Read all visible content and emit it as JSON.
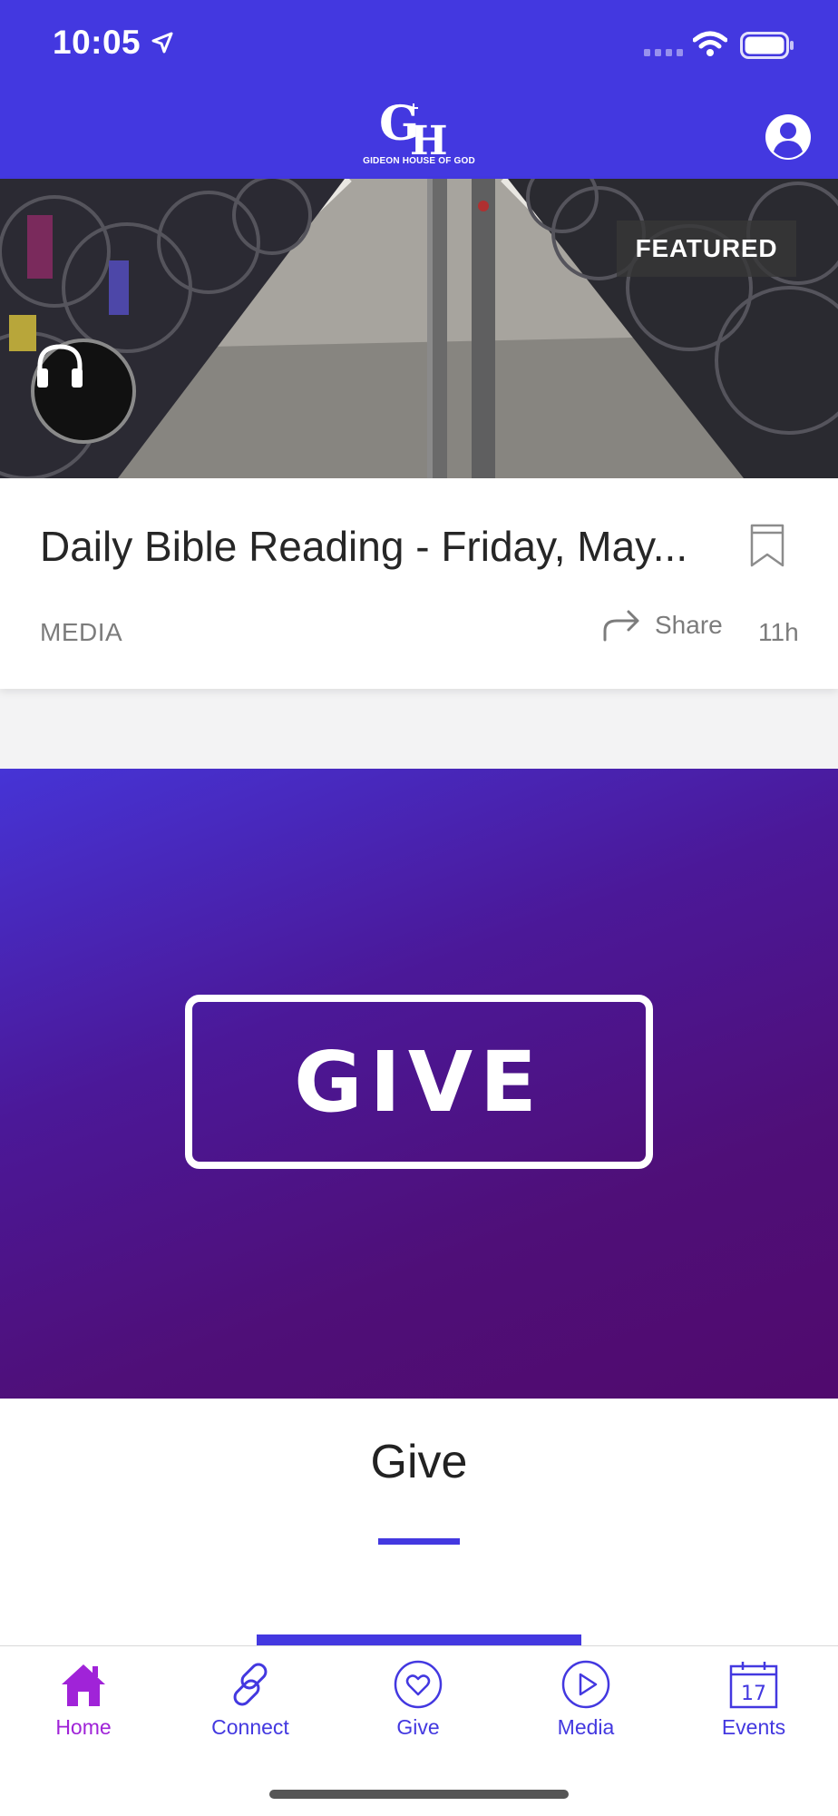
{
  "status_bar": {
    "time": "10:05"
  },
  "header": {
    "logo_mark": "GH",
    "logo_text": "GIDEON HOUSE OF GOD",
    "profile_icon": "person-circle-icon"
  },
  "featured_card": {
    "badge": "FEATURED",
    "media_icon": "headphones-icon",
    "title": "Daily Bible Reading - Friday, May...",
    "category": "MEDIA",
    "share_label": "Share",
    "age": "11h"
  },
  "give_banner": {
    "box_text": "GIVE",
    "title": "Give"
  },
  "colors": {
    "brand": "#4338e0",
    "active_tab": "#a023d8",
    "banner_end": "#500a6d"
  },
  "tabs": [
    {
      "label": "Home",
      "icon": "home-icon",
      "active": true
    },
    {
      "label": "Connect",
      "icon": "link-icon",
      "active": false
    },
    {
      "label": "Give",
      "icon": "heart-circle-icon",
      "active": false
    },
    {
      "label": "Media",
      "icon": "play-circle-icon",
      "active": false
    },
    {
      "label": "Events",
      "icon": "calendar-icon",
      "active": false
    }
  ],
  "events_calendar_day": "17"
}
